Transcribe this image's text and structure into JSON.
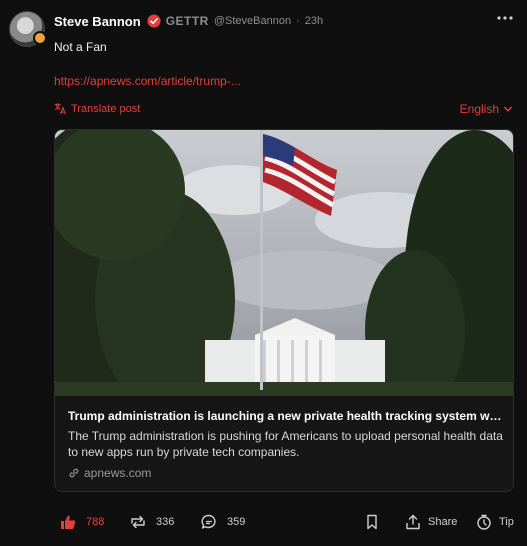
{
  "post": {
    "author_name": "Steve Bannon",
    "platform_brand": "GETTR",
    "handle": "@SteveBannon",
    "separator": "·",
    "timestamp": "23h",
    "text": "Not a Fan",
    "link": "https://apnews.com/article/trump-...",
    "translate_label": "Translate post",
    "language": "English"
  },
  "card": {
    "title": "Trump administration is launching a new private health tracking system with B...",
    "description": "The Trump administration is pushing for Americans to upload personal health data to new apps run by private tech companies.",
    "domain": "apnews.com"
  },
  "actions": {
    "likes": "788",
    "reposts": "336",
    "comments": "359",
    "share_label": "Share",
    "tip_label": "Tip"
  },
  "colors": {
    "accent": "#e0403a",
    "background": "#0f0f10",
    "card_border": "#2c2c2e",
    "muted_text": "#8e8e8e"
  },
  "icons": [
    "more-icon",
    "verified-icon",
    "translate-icon",
    "chevron-down-icon",
    "link-icon",
    "like-icon",
    "repost-icon",
    "comment-icon",
    "bookmark-icon",
    "share-icon",
    "tip-icon"
  ]
}
